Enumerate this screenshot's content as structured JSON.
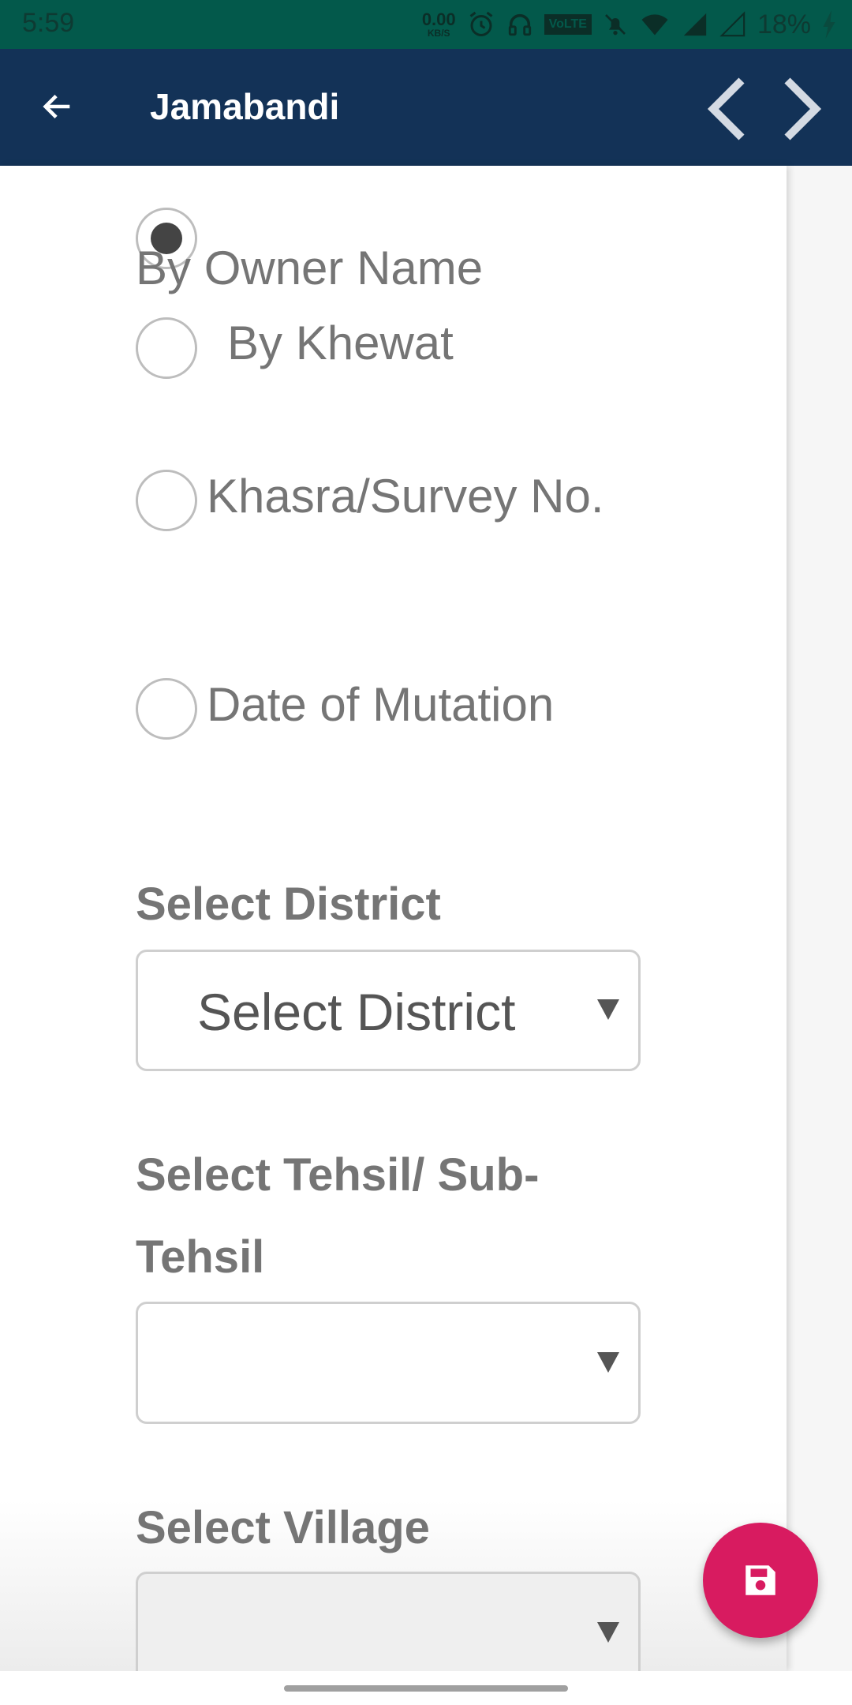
{
  "status_bar": {
    "time": "5:59",
    "net_speed_value": "0.00",
    "net_speed_unit": "KB/S",
    "volte": "VoLTE",
    "battery": "18%",
    "icons": [
      "alarm-icon",
      "headphones-icon",
      "volte-icon",
      "bell-off-icon",
      "wifi-icon",
      "signal-icon",
      "signal-empty-icon",
      "charging-icon"
    ]
  },
  "app_bar": {
    "title": "Jamabandi",
    "back_icon": "arrow-left-icon",
    "prev_icon": "chevron-left-icon",
    "next_icon": "chevron-right-icon"
  },
  "search_by": {
    "options": [
      {
        "label": "By Owner Name",
        "checked": true
      },
      {
        "label": "By Khewat",
        "checked": false
      },
      {
        "label": "Khasra/Survey No.",
        "checked": false
      },
      {
        "label": "Date of Mutation",
        "checked": false
      }
    ]
  },
  "fields": {
    "district": {
      "label": "Select District",
      "value": "Select District"
    },
    "tehsil": {
      "label_line1": "Select Tehsil/ Sub-",
      "label_line2": "Tehsil",
      "value": ""
    },
    "village": {
      "label": "Select Village",
      "value": ""
    }
  },
  "fab": {
    "icon": "save-icon",
    "color": "#d81b60"
  },
  "colors": {
    "status_bar": "#03594b",
    "app_bar": "#133257",
    "text": "#757575"
  }
}
